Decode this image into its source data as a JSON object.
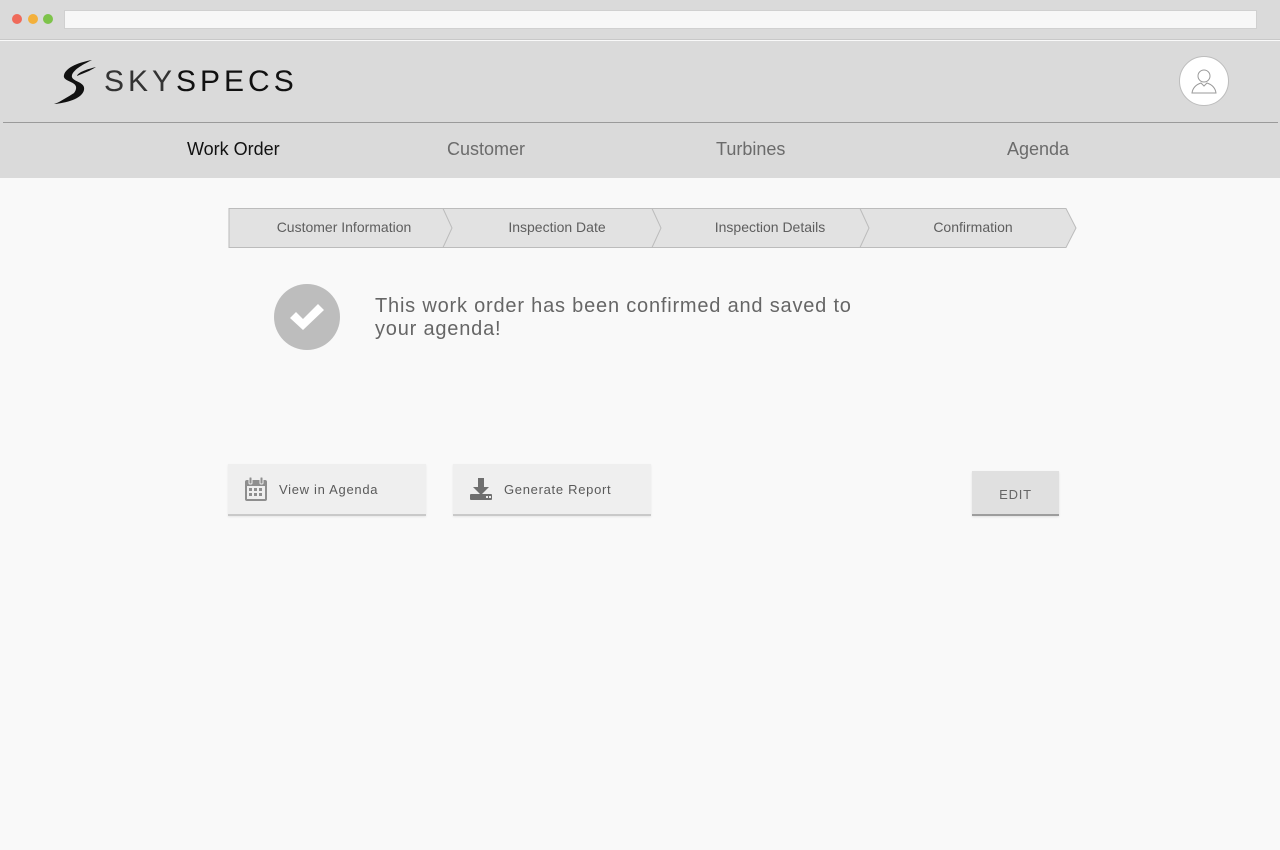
{
  "app": {
    "brand_light": "SKY",
    "brand_bold": "SPECS",
    "avatar_icon": "user-icon"
  },
  "nav": {
    "items": [
      {
        "label": "Work Order",
        "active": true
      },
      {
        "label": "Customer",
        "active": false
      },
      {
        "label": "Turbines",
        "active": false
      },
      {
        "label": "Agenda",
        "active": false
      }
    ]
  },
  "stepper": {
    "steps": [
      {
        "label": "Customer Information"
      },
      {
        "label": "Inspection Date"
      },
      {
        "label": "Inspection Details"
      },
      {
        "label": "Confirmation"
      }
    ]
  },
  "confirmation": {
    "icon": "checkmark-icon",
    "message": "This work order has been confirmed and saved to your agenda!"
  },
  "actions": {
    "view_agenda": {
      "label": "View in Agenda",
      "icon": "calendar-icon"
    },
    "generate_report": {
      "label": "Generate Report",
      "icon": "download-icon"
    },
    "edit": {
      "label": "EDIT"
    }
  },
  "colors": {
    "header_bg": "#dadada",
    "page_bg": "#f9f9f9",
    "check_circle": "#bdbdbd"
  }
}
